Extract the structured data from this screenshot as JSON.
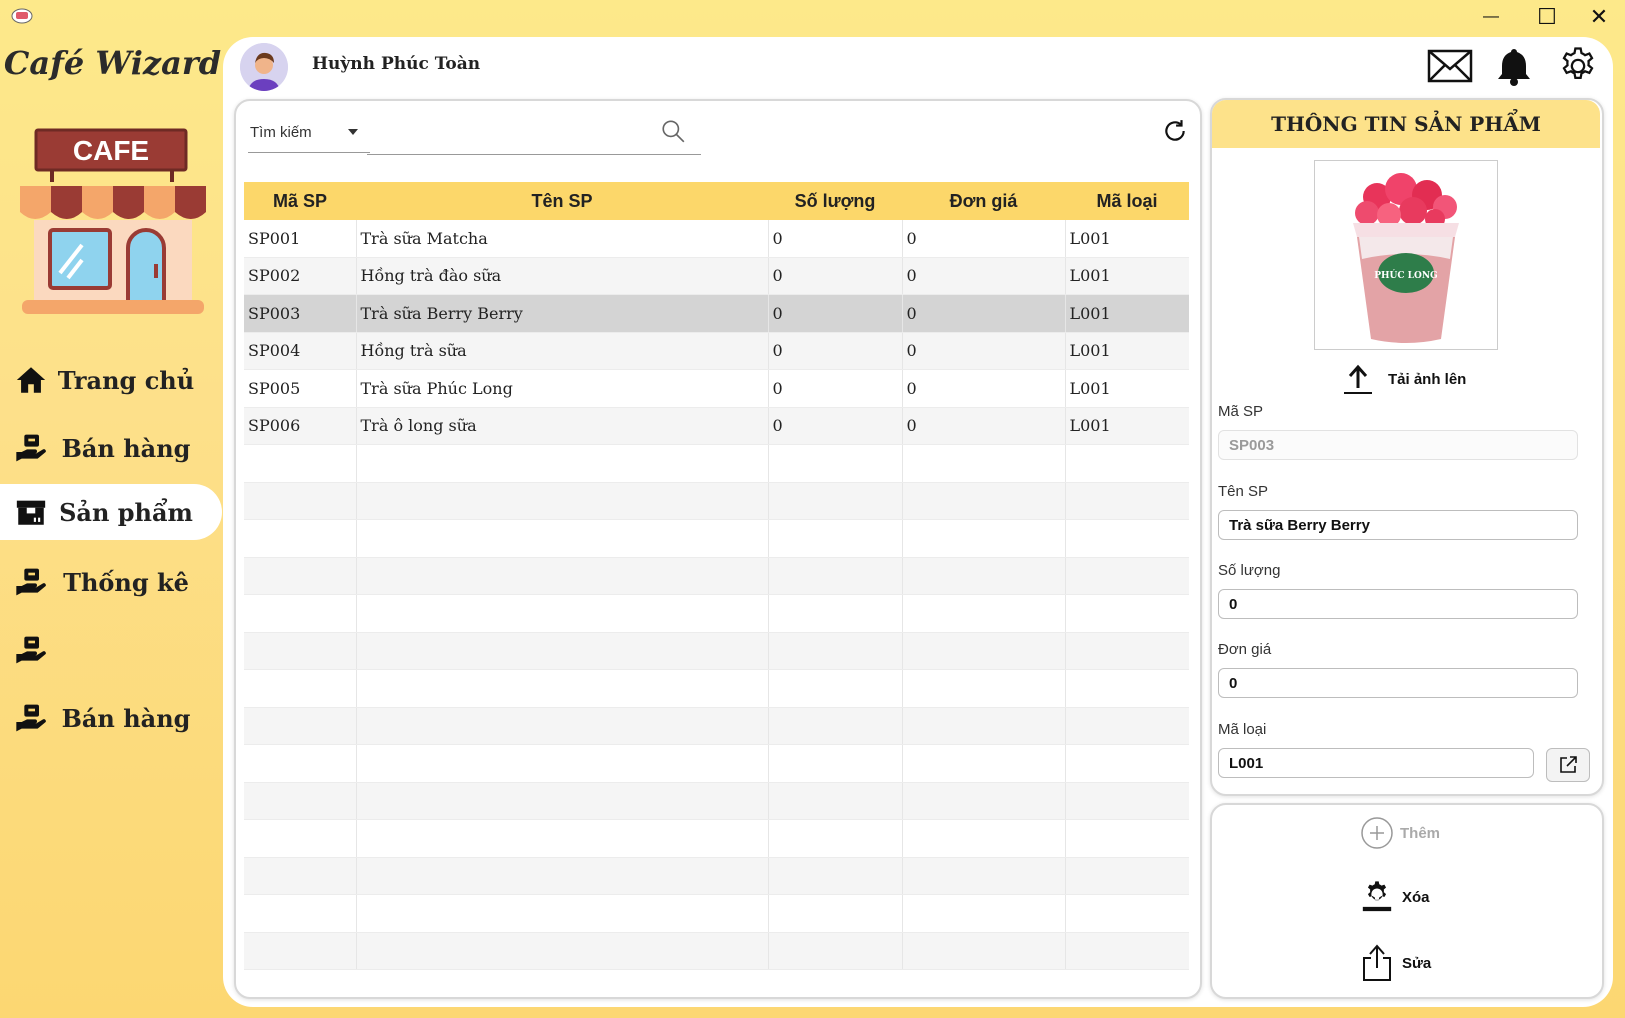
{
  "window": {
    "minimize_glyph": "—",
    "maximize_glyph": "☐",
    "close_glyph": "✕"
  },
  "brand": {
    "title": "Café Wizard",
    "logo_sign": "CAFE"
  },
  "sidebar": {
    "items": [
      {
        "label": "Trang chủ",
        "icon": "home-icon"
      },
      {
        "label": "Bán hàng",
        "icon": "hand-box-icon"
      },
      {
        "label": "Sản phẩm",
        "icon": "package-icon",
        "active": true
      },
      {
        "label": "Thống kê",
        "icon": "hand-box-icon"
      },
      {
        "label": "",
        "icon": "hand-box-icon"
      },
      {
        "label": "Bán hàng",
        "icon": "hand-box-icon"
      }
    ]
  },
  "header": {
    "user_name": "Huỳnh Phúc Toàn",
    "icons": [
      "mail-icon",
      "bell-icon",
      "gear-icon"
    ]
  },
  "search": {
    "combo_label": "Tìm kiếm",
    "value": "",
    "placeholder": ""
  },
  "table": {
    "columns": [
      "Mã SP",
      "Tên SP",
      "Số lượng",
      "Đơn giá",
      "Mã loại"
    ],
    "rows": [
      [
        "SP001",
        "Trà sữa Matcha",
        "0",
        "0",
        "L001"
      ],
      [
        "SP002",
        "Hồng trà đào sữa",
        "0",
        "0",
        "L001"
      ],
      [
        "SP003",
        "Trà sữa Berry Berry",
        "0",
        "0",
        "L001"
      ],
      [
        "SP004",
        "Hồng trà sữa",
        "0",
        "0",
        "L001"
      ],
      [
        "SP005",
        "Trà sữa Phúc Long",
        "0",
        "0",
        "L001"
      ],
      [
        "SP006",
        "Trà ô long sữa",
        "0",
        "0",
        "L001"
      ]
    ],
    "selected_index": 2
  },
  "detail": {
    "title": "THÔNG TIN SẢN PHẨM",
    "upload_label": "Tải ảnh lên",
    "cup_brand": "PHÚC LONG",
    "fields": {
      "ma_sp_label": "Mã SP",
      "ma_sp_value": "SP003",
      "ten_sp_label": "Tên SP",
      "ten_sp_value": "Trà sữa Berry Berry",
      "so_luong_label": "Số lượng",
      "so_luong_value": "0",
      "don_gia_label": "Đơn giá",
      "don_gia_value": "0",
      "ma_loai_label": "Mã loại",
      "ma_loai_value": "L001"
    }
  },
  "actions": {
    "add_label": "Thêm",
    "delete_label": "Xóa",
    "edit_label": "Sửa"
  },
  "colors": {
    "accent": "#fcd76a",
    "background": "#fde98a",
    "selected_row": "#d4d4d4"
  }
}
